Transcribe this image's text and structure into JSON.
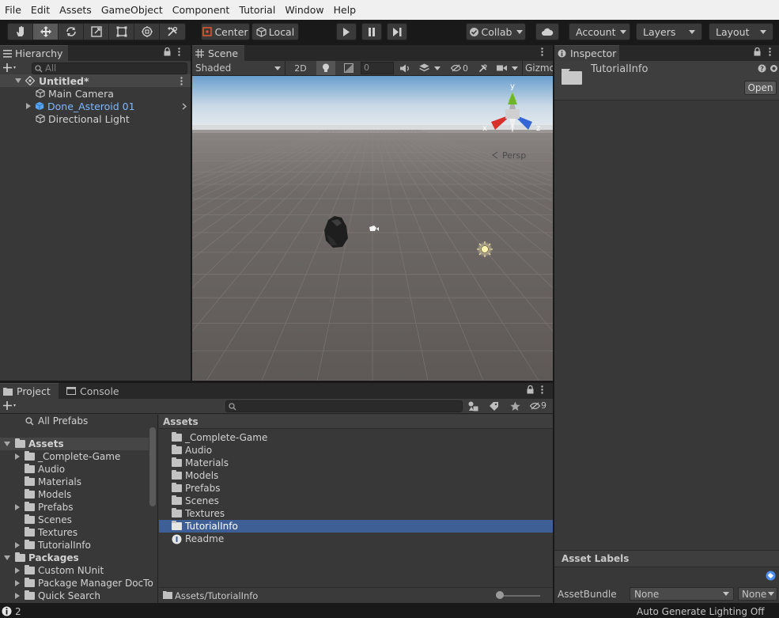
{
  "menu": [
    "File",
    "Edit",
    "Assets",
    "GameObject",
    "Component",
    "Tutorial",
    "Window",
    "Help"
  ],
  "toolbar": {
    "pivot": "Center",
    "space": "Local",
    "collab": "Collab",
    "account": "Account",
    "layers": "Layers",
    "layout": "Layout"
  },
  "hierarchy": {
    "tab": "Hierarchy",
    "search_placeholder": "All",
    "scene": "Untitled*",
    "items": [
      "Main Camera",
      "Done_Asteroid 01",
      "Directional Light"
    ]
  },
  "scene": {
    "tab": "Scene",
    "shading": "Shaded",
    "mode_2d": "2D",
    "fx_value": "0",
    "hidden_count": "0",
    "gizmos": "Gizmo",
    "persp": "Persp",
    "axis_y": "y",
    "axis_x": "x",
    "axis_z": "z"
  },
  "inspector": {
    "tab": "Inspector",
    "asset_name": "TutorialInfo",
    "open_button": "Open",
    "labels_title": "Asset Labels",
    "bundle_label": "AssetBundle",
    "bundle_value": "None",
    "variant_value": "None"
  },
  "project": {
    "tab": "Project",
    "console_tab": "Console",
    "badge_count": "9",
    "favorites": "All Prefabs",
    "tree_assets": "Assets",
    "tree_items": [
      "_Complete-Game",
      "Audio",
      "Materials",
      "Models",
      "Prefabs",
      "Scenes",
      "Textures",
      "TutorialInfo"
    ],
    "tree_packages": "Packages",
    "package_items": [
      "Custom NUnit",
      "Package Manager DocTo",
      "Quick Search"
    ],
    "breadcrumb_header": "Assets",
    "folders": [
      "_Complete-Game",
      "Audio",
      "Materials",
      "Models",
      "Prefabs",
      "Scenes",
      "Textures",
      "TutorialInfo"
    ],
    "files": [
      "Readme"
    ],
    "path": "Assets/TutorialInfo"
  },
  "status": {
    "count": "2",
    "lighting": "Auto Generate Lighting Off"
  },
  "colors": {
    "selection": "#3e5f96",
    "panel": "#383838",
    "toolbar_bg": "#191919",
    "prefab_blue": "#7db8ff"
  }
}
